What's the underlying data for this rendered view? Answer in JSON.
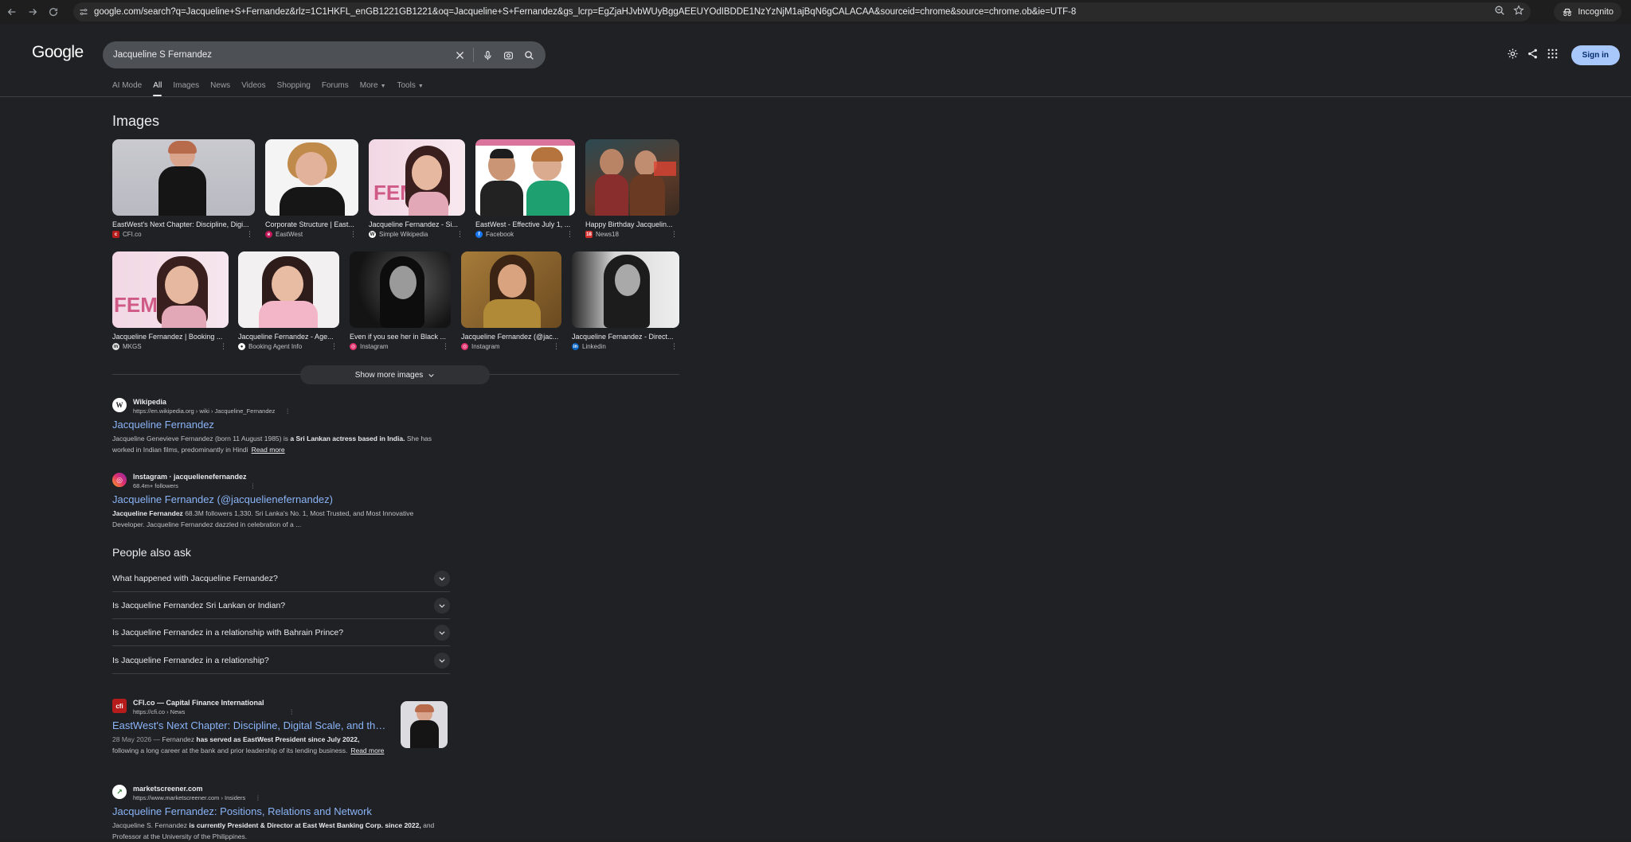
{
  "browser": {
    "url": "google.com/search?q=Jacqueline+S+Fernandez&rlz=1C1HKFL_enGB1221GB1221&oq=Jacqueline+S+Fernandez&gs_lcrp=EgZjaHJvbWUyBggAEEUYOdIBDDE1NzYzNjM1ajBqN6gCALACAA&sourceid=chrome&source=chrome.ob&ie=UTF-8",
    "incognito_label": "Incognito"
  },
  "header": {
    "logo": "Google",
    "search_value": "Jacqueline S Fernandez",
    "tabs": [
      "AI Mode",
      "All",
      "Images",
      "News",
      "Videos",
      "Shopping",
      "Forums",
      "More",
      "Tools"
    ],
    "signin": "Sign in"
  },
  "images": {
    "title": "Images",
    "show_more": "Show more images",
    "row1": [
      {
        "caption": "EastWest's Next Chapter: Discipline, Digi...",
        "source": "CFI.co",
        "color": "#b71c1c"
      },
      {
        "caption": "Corporate Structure | East...",
        "source": "EastWest",
        "color": "#c2185b"
      },
      {
        "caption": "Jacqueline Fernandez - Si...",
        "source": "Simple Wikipedia",
        "color": "#ffffff"
      },
      {
        "caption": "EastWest - Effective July 1, ...",
        "source": "Facebook",
        "color": "#1877f2"
      },
      {
        "caption": "Happy Birthday Jacquelin...",
        "source": "News18",
        "color": "#d32f2f"
      }
    ],
    "row2": [
      {
        "caption": "Jacqueline Fernandez | Booking ...",
        "source": "MKGS",
        "color": "#e0e0e0"
      },
      {
        "caption": "Jacqueline Fernandez - Age...",
        "source": "Booking Agent Info",
        "color": "#ffffff"
      },
      {
        "caption": "Even if you see her in Black ...",
        "source": "Instagram",
        "color": "#e1306c"
      },
      {
        "caption": "Jacqueline Fernandez (@jac...",
        "source": "Instagram",
        "color": "#e1306c"
      },
      {
        "caption": "Jacqueline Fernandez - Direct...",
        "source": "Linkedin",
        "color": "#0a66c2"
      }
    ]
  },
  "results": {
    "wiki": {
      "site": "Wikipedia",
      "url": "https://en.wikipedia.org › wiki › Jacqueline_Fernandez",
      "title": "Jacqueline Fernandez",
      "snippet_a": "Jacqueline Genevieve Fernandez (born 11 August 1985) is",
      "snippet_b": "a Sri Lankan actress based in India.",
      "snippet_c": "She has worked in Indian films, predominantly in Hindi",
      "readmore": "Read more"
    },
    "insta": {
      "site": "Instagram · jacquelienefernandez",
      "url": "68.4m+ followers",
      "title": "Jacqueline Fernandez (@jacquelienefernandez)",
      "snippet_bold": "Jacqueline Fernandez",
      "snippet_rest": "68.3M followers 1,330. Sri Lanka's No. 1, Most Trusted, and Most Innovative Developer. Jacqueline Fernandez dazzled in celebration of a ..."
    },
    "cfi": {
      "site": "CFI.co — Capital Finance International",
      "url": "https://cfi.co › News",
      "title": "EastWest's Next Chapter: Discipline, Digital Scale, and the ...",
      "date": "28 May 2026 —",
      "snippet_a": "Fernandez",
      "snippet_b": "has served as EastWest President since July 2022,",
      "snippet_c": "following a long career at the bank and prior leadership of its lending business.",
      "readmore": "Read more"
    },
    "ms": {
      "site": "marketscreener.com",
      "url": "https://www.marketscreener.com › Insiders",
      "title": "Jacqueline Fernandez: Positions, Relations and Network",
      "snippet_a": "Jacqueline S. Fernandez",
      "snippet_b": "is currently President & Director at East West Banking Corp. since 2022,",
      "snippet_c": "and Professor at the University of the Philippines."
    }
  },
  "paa": {
    "title": "People also ask",
    "questions": [
      "What happened with Jacqueline Fernandez?",
      "Is Jacqueline Fernandez Sri Lankan or Indian?",
      "Is Jacqueline Fernandez in a relationship with Bahrain Prince?",
      "Is Jacqueline Fernandez in a relationship?"
    ]
  }
}
